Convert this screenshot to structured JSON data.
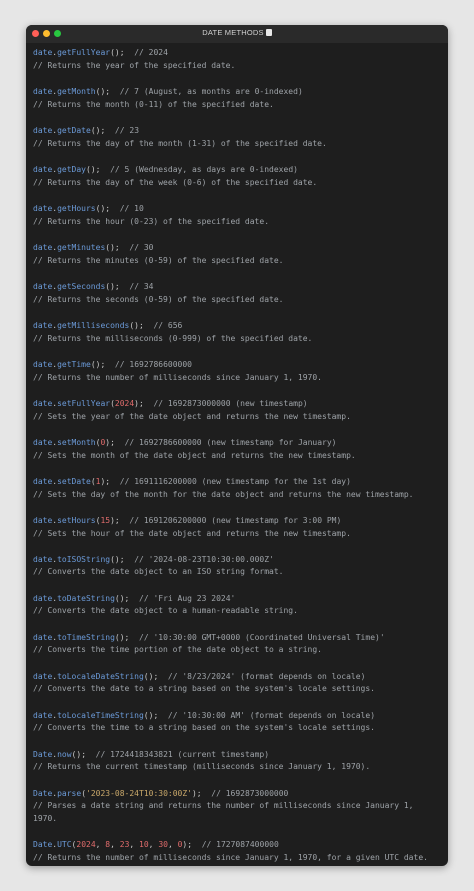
{
  "window": {
    "title": "DATE METHODS"
  },
  "blocks": [
    {
      "obj": "date",
      "method": "getFullYear",
      "args": [],
      "result": "// 2024",
      "desc": "// Returns the year of the specified date."
    },
    {
      "obj": "date",
      "method": "getMonth",
      "args": [],
      "result": "// 7 (August, as months are 0-indexed)",
      "desc": "// Returns the month (0-11) of the specified date."
    },
    {
      "obj": "date",
      "method": "getDate",
      "args": [],
      "result": "// 23",
      "desc": "// Returns the day of the month (1-31) of the specified date."
    },
    {
      "obj": "date",
      "method": "getDay",
      "args": [],
      "result": "// 5 (Wednesday, as days are 0-indexed)",
      "desc": "// Returns the day of the week (0-6) of the specified date."
    },
    {
      "obj": "date",
      "method": "getHours",
      "args": [],
      "result": "// 10",
      "desc": "// Returns the hour (0-23) of the specified date."
    },
    {
      "obj": "date",
      "method": "getMinutes",
      "args": [],
      "result": "// 30",
      "desc": "// Returns the minutes (0-59) of the specified date."
    },
    {
      "obj": "date",
      "method": "getSeconds",
      "args": [],
      "result": "// 34",
      "desc": "// Returns the seconds (0-59) of the specified date."
    },
    {
      "obj": "date",
      "method": "getMilliseconds",
      "args": [],
      "result": "// 656",
      "desc": "// Returns the milliseconds (0-999) of the specified date."
    },
    {
      "obj": "date",
      "method": "getTime",
      "args": [],
      "result": "// 1692786600000",
      "desc": "// Returns the number of milliseconds since January 1, 1970."
    },
    {
      "obj": "date",
      "method": "setFullYear",
      "args": [
        {
          "t": "num",
          "v": "2024"
        }
      ],
      "result": "// 1692873000000 (new timestamp)",
      "desc": "// Sets the year of the date object and returns the new timestamp."
    },
    {
      "obj": "date",
      "method": "setMonth",
      "args": [
        {
          "t": "num",
          "v": "0"
        }
      ],
      "result": "// 1692786600000 (new timestamp for January)",
      "desc": "// Sets the month of the date object and returns the new timestamp."
    },
    {
      "obj": "date",
      "method": "setDate",
      "args": [
        {
          "t": "num",
          "v": "1"
        }
      ],
      "result": "// 1691116200000 (new timestamp for the 1st day)",
      "desc": "// Sets the day of the month for the date object and returns the new timestamp."
    },
    {
      "obj": "date",
      "method": "setHours",
      "args": [
        {
          "t": "num",
          "v": "15"
        }
      ],
      "result": "// 1691206200000 (new timestamp for 3:00 PM)",
      "desc": "// Sets the hour of the date object and returns the new timestamp."
    },
    {
      "obj": "date",
      "method": "toISOString",
      "args": [],
      "result": "// '2024-08-23T10:30:00.000Z'",
      "desc": "// Converts the date object to an ISO string format."
    },
    {
      "obj": "date",
      "method": "toDateString",
      "args": [],
      "result": "// 'Fri Aug 23 2024'",
      "desc": "// Converts the date object to a human-readable string."
    },
    {
      "obj": "date",
      "method": "toTimeString",
      "args": [],
      "result": "// '10:30:00 GMT+0000 (Coordinated Universal Time)'",
      "desc": "// Converts the time portion of the date object to a string."
    },
    {
      "obj": "date",
      "method": "toLocaleDateString",
      "args": [],
      "result": "// '8/23/2024' (format depends on locale)",
      "desc": "// Converts the date to a string based on the system's locale settings."
    },
    {
      "obj": "date",
      "method": "toLocaleTimeString",
      "args": [],
      "result": "// '10:30:00 AM' (format depends on locale)",
      "desc": "// Converts the time to a string based on the system's locale settings."
    },
    {
      "obj": "Date",
      "method": "now",
      "args": [],
      "result": "// 1724418343821 (current timestamp)",
      "desc": "// Returns the current timestamp (milliseconds since January 1, 1970)."
    },
    {
      "obj": "Date",
      "method": "parse",
      "args": [
        {
          "t": "str",
          "v": "'2023-08-24T10:30:00Z'"
        }
      ],
      "result": "// 1692873000000",
      "desc": "// Parses a date string and returns the number of milliseconds since January 1,\n1970."
    },
    {
      "obj": "Date",
      "method": "UTC",
      "args": [
        {
          "t": "num",
          "v": "2024"
        },
        {
          "t": "num",
          "v": "8"
        },
        {
          "t": "num",
          "v": "23"
        },
        {
          "t": "num",
          "v": "10"
        },
        {
          "t": "num",
          "v": "30"
        },
        {
          "t": "num",
          "v": "0"
        }
      ],
      "result": "// 1727087400000",
      "desc": "// Returns the number of milliseconds since January 1, 1970, for a given UTC date."
    }
  ]
}
